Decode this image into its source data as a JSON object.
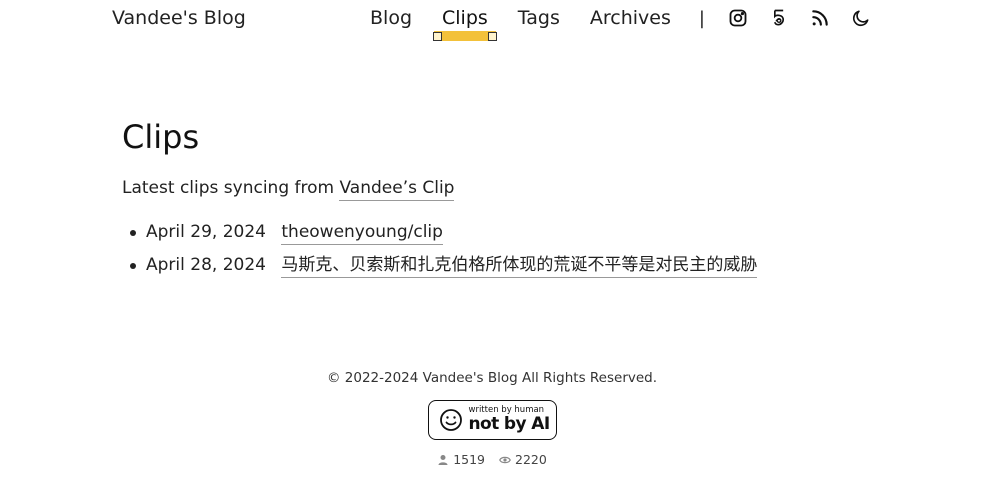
{
  "header": {
    "site_title": "Vandee's Blog",
    "nav": [
      {
        "label": "Blog"
      },
      {
        "label": "Clips"
      },
      {
        "label": "Tags"
      },
      {
        "label": "Archives"
      }
    ],
    "separator": "|",
    "active_nav": "Clips",
    "highlight_color": "#f3c13a"
  },
  "main": {
    "title": "Clips",
    "intro_text": "Latest clips syncing from",
    "intro_link": "Vandee’s Clip",
    "clips": [
      {
        "date": "April 29, 2024",
        "title": "theowenyoung/clip"
      },
      {
        "date": "April 28, 2024",
        "title": "马斯克、贝索斯和扎克伯格所体现的荒诞不平等是对民主的威胁"
      }
    ]
  },
  "footer": {
    "copyright": "© 2022-2024 Vandee's Blog All Rights Reserved.",
    "badge_small": "written by human",
    "badge_big": "not by AI",
    "visitors": "1519",
    "views": "2220"
  }
}
